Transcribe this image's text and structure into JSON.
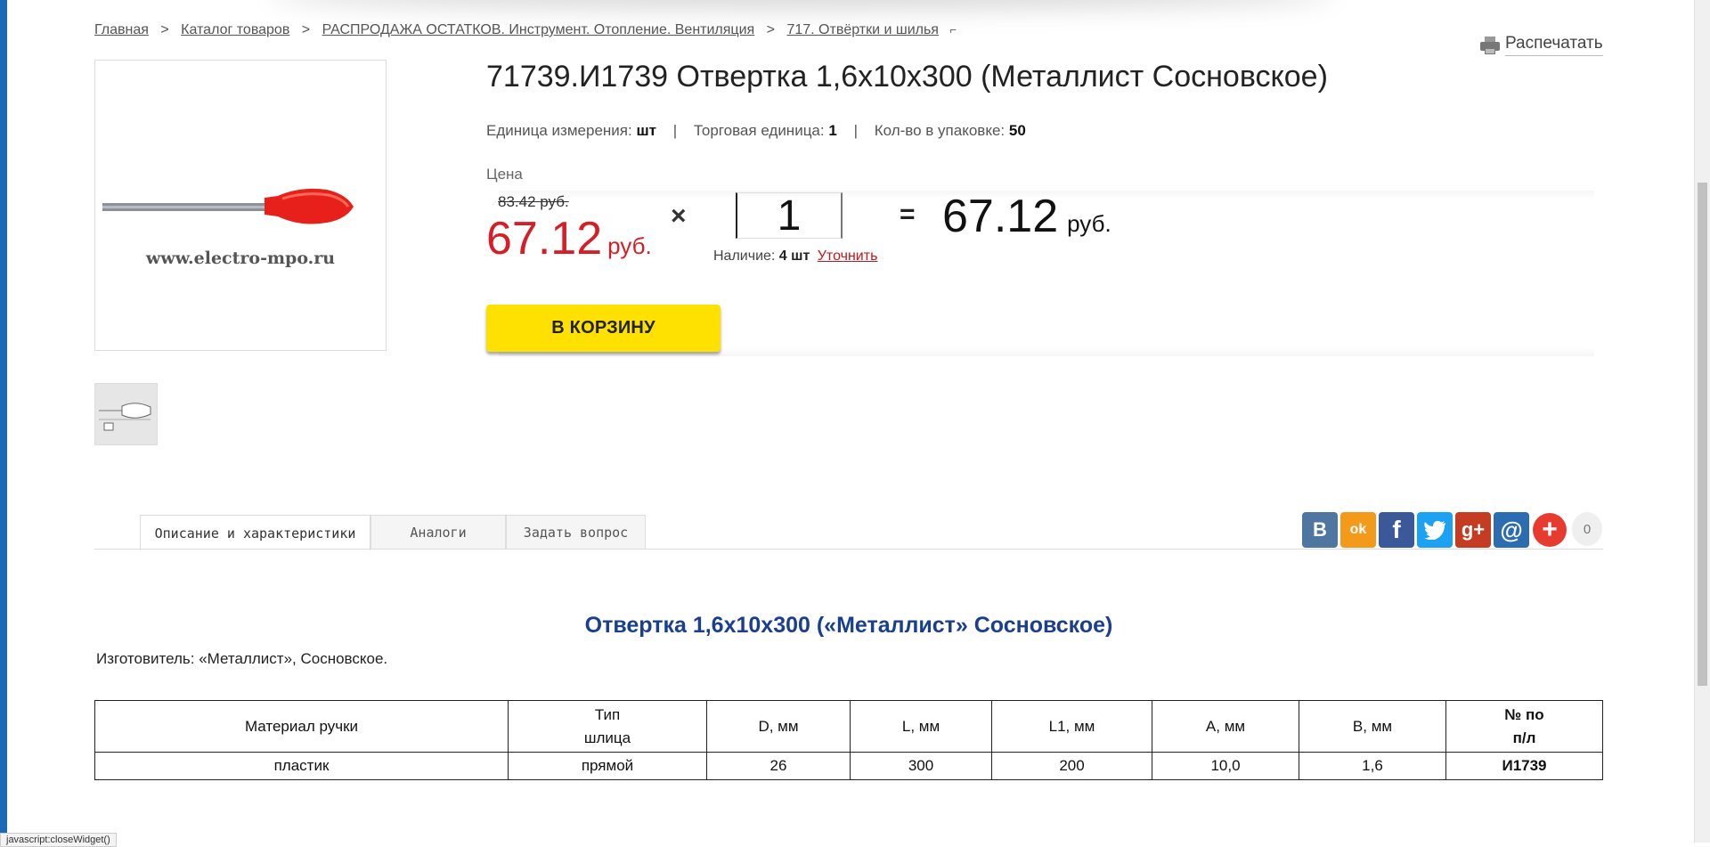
{
  "breadcrumb": {
    "items": [
      "Главная",
      "Каталог товаров",
      "РАСПРОДАЖА ОСТАТКОВ. Инструмент. Отопление. Вентиляция",
      "717. Отвёртки и шилья"
    ],
    "separator": ">",
    "expand_glyph": "⌐"
  },
  "print": {
    "label": "Распечатать",
    "icon": "printer-icon"
  },
  "product": {
    "title": "71739.И1739 Отвертка 1,6х10х300 (Металлист Сосновское)",
    "image_watermark": "www.electro-mpo.ru",
    "units": {
      "unit_label": "Единица измерения:",
      "unit_value": "шт",
      "trade_label": "Торговая единица:",
      "trade_value": "1",
      "pack_label": "Кол-во в упаковке:",
      "pack_value": "50",
      "divider": "|"
    }
  },
  "pricing": {
    "label": "Цена",
    "old_price": "83.42 руб.",
    "price": "67.12",
    "currency": "руб.",
    "times_sign": "×",
    "quantity": "1",
    "equals_sign": "=",
    "total": "67.12",
    "total_currency": "руб.",
    "stock_label": "Наличие:",
    "stock_value": "4 шт",
    "stock_link": "Уточнить",
    "price_color": "#d51e26"
  },
  "cart_button": {
    "label": "В КОРЗИНУ",
    "color": "#ffe100"
  },
  "tabs": [
    {
      "label": "Описание и характеристики",
      "active": true
    },
    {
      "label": "Аналоги",
      "active": false
    },
    {
      "label": "Задать вопрос",
      "active": false
    }
  ],
  "share": {
    "buttons": [
      "vk-icon",
      "odnoklassniki-icon",
      "facebook-icon",
      "twitter-icon",
      "google-plus-icon",
      "mail-icon",
      "more-icon"
    ],
    "vk": "B",
    "ok": "ok",
    "fb": "f",
    "gp": "g+",
    "mail": "@",
    "plus": "+",
    "count": "0"
  },
  "description": {
    "title": "Отвертка 1,6х10х300 («Металлист» Сосновское)",
    "maker": "Изготовитель: «Металлист», Сосновское."
  },
  "specs": {
    "headers": [
      "Материал ручки",
      "Тип шлица",
      "D, мм",
      "L, мм",
      "L1, мм",
      "А, мм",
      "В, мм",
      "№ по п/л"
    ],
    "headers_split": {
      "type_1": "Тип",
      "type_2": "шлица",
      "num_1": "№ по",
      "num_2": "п/л"
    },
    "row": [
      "пластик",
      "прямой",
      "26",
      "300",
      "200",
      "10,0",
      "1,6",
      "И1739"
    ]
  },
  "status_bar": {
    "text": "javascript:closeWidget()"
  }
}
